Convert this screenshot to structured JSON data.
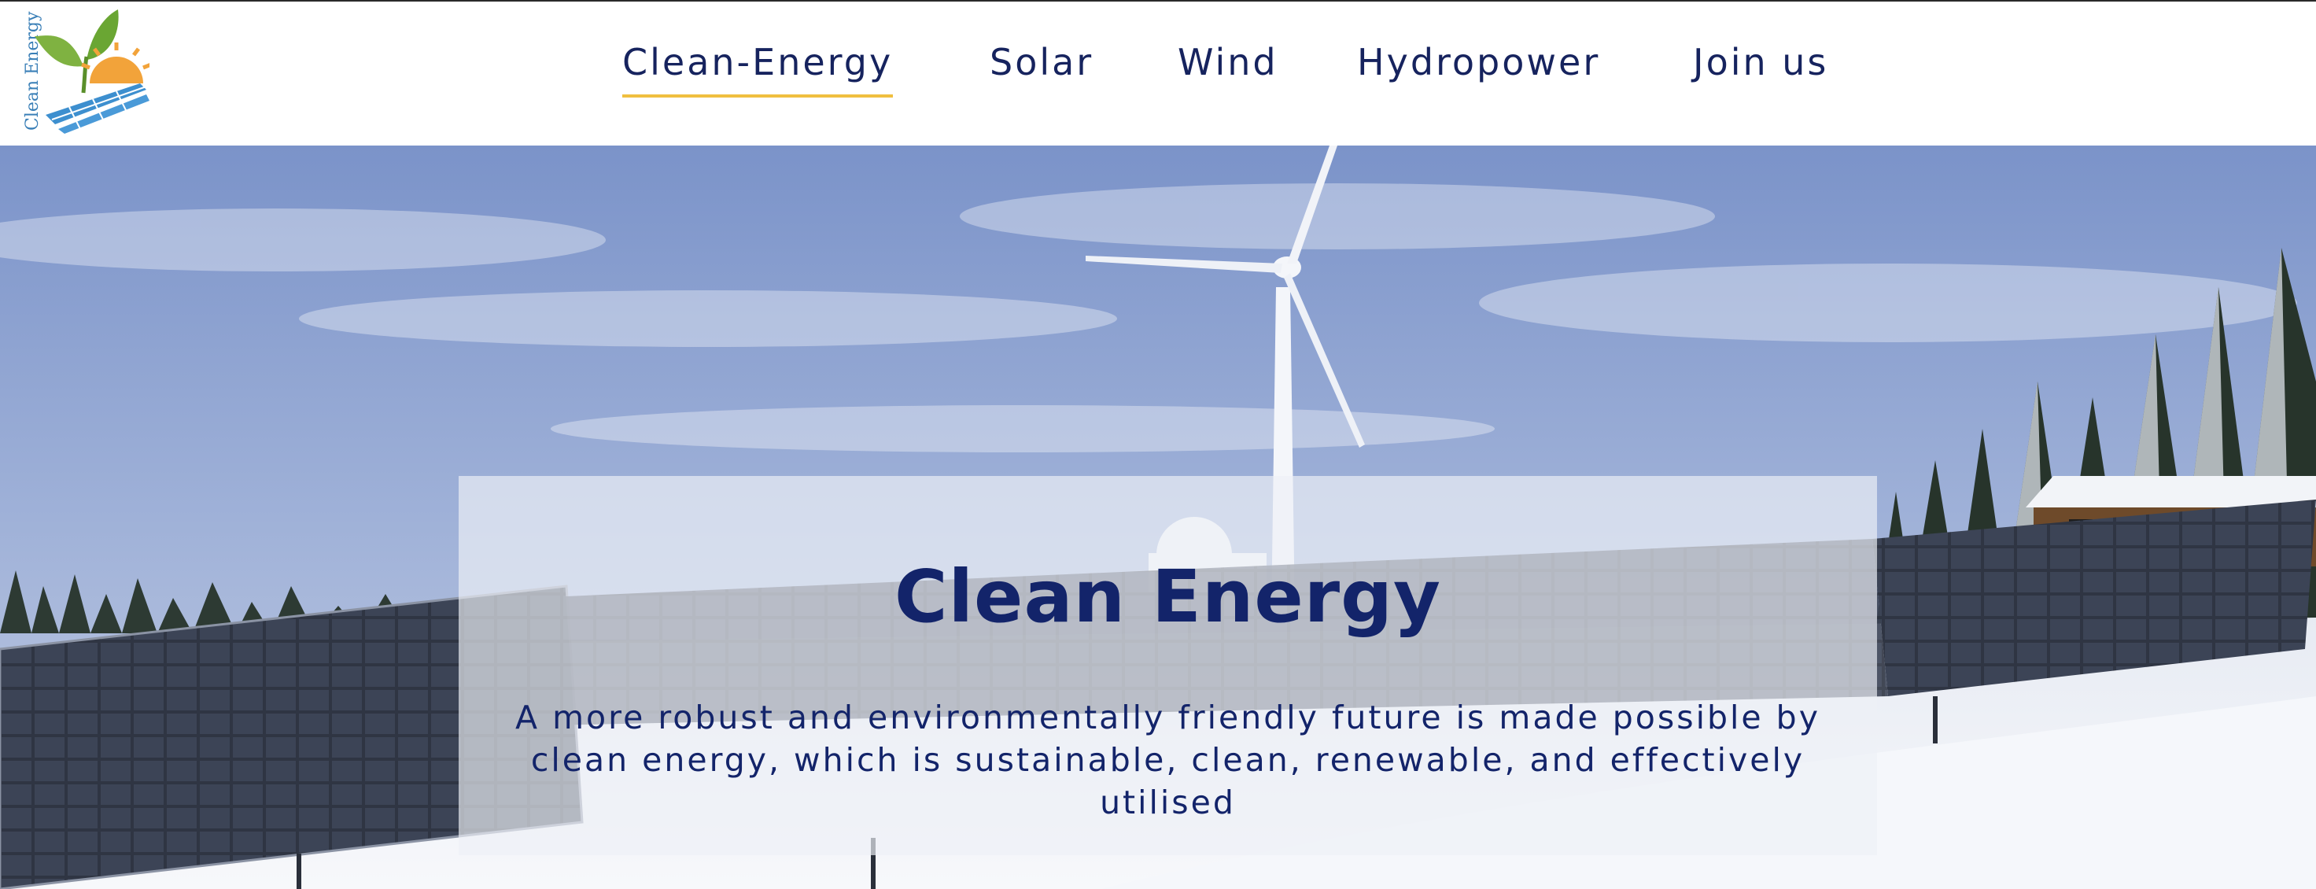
{
  "logo": {
    "text": "Clean Energy",
    "icon": "sprout-sun-solar-logo",
    "colors": {
      "leaf": "#7fb241",
      "sun": "#f2a33a",
      "panel": "#3d8fcf",
      "text": "#3a7fb7"
    }
  },
  "nav": {
    "items": [
      {
        "label": "Clean-Energy",
        "active": true
      },
      {
        "label": "Solar"
      },
      {
        "label": "Wind"
      },
      {
        "label": "Hydropower"
      },
      {
        "label": "Join us"
      }
    ],
    "active_underline_color": "#f0bf3f",
    "text_color": "#16235e"
  },
  "hero": {
    "image": "wind-turbine-and-solar-panels-in-snow",
    "title": "Clean Energy",
    "description": "A more robust and environmentally friendly future is made possible by clean energy, which is sustainable, clean, renewable, and effectively utilised",
    "text_color": "#13246a"
  }
}
